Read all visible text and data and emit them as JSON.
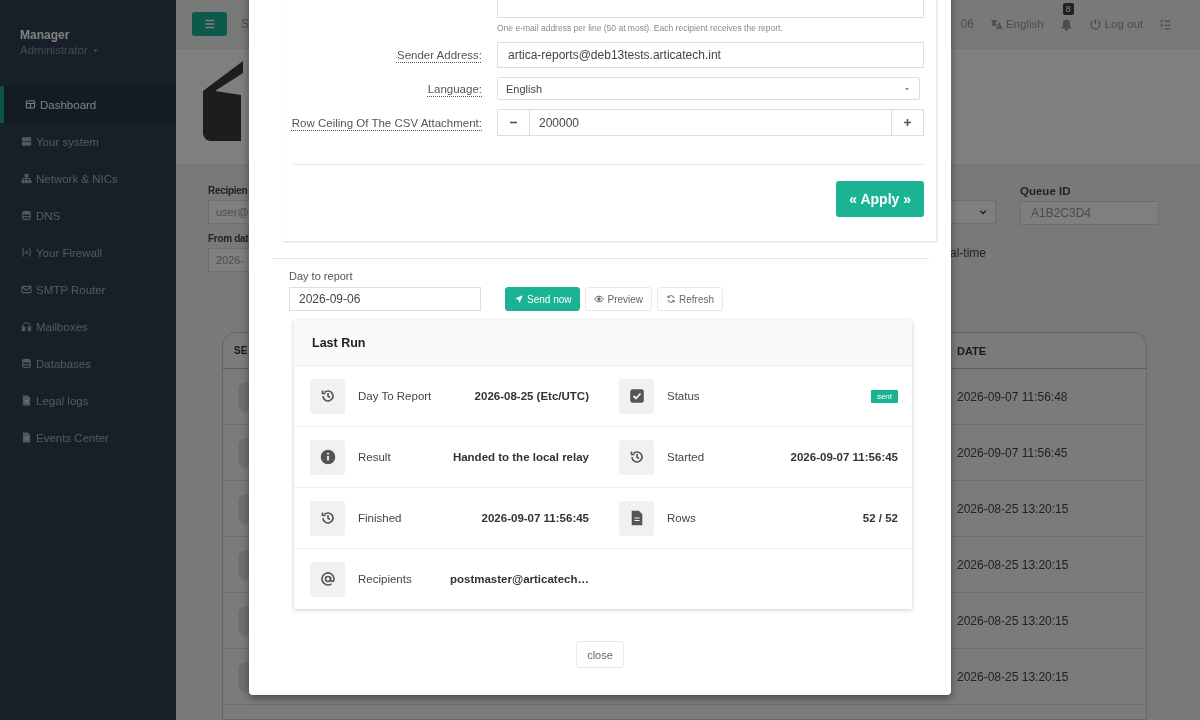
{
  "sidebar": {
    "user": "Manager",
    "role": "Administrator",
    "items": [
      {
        "label": "Dashboard",
        "selected": true
      },
      {
        "label": "Your system",
        "selected": false
      },
      {
        "label": "Network & NICs",
        "selected": false
      },
      {
        "label": "DNS",
        "selected": false
      },
      {
        "label": "Your Firewall",
        "selected": false
      },
      {
        "label": "SMTP Router",
        "selected": false
      },
      {
        "label": "Mailboxes",
        "selected": false
      },
      {
        "label": "Databases",
        "selected": false
      },
      {
        "label": "Legal logs",
        "selected": false
      },
      {
        "label": "Events Center",
        "selected": false
      }
    ]
  },
  "topbar": {
    "search_partial": "S",
    "date_partial": "06",
    "language": "English",
    "notifications": "8",
    "logout": "Log out"
  },
  "filters": {
    "recipient_label": "Recipien",
    "recipient_placeholder": "user@",
    "from_label": "From dat",
    "from_value": "2026-",
    "queue_label": "Queue ID",
    "queue_placeholder": "A1B2C3D4",
    "realtime_label": "al-time"
  },
  "table": {
    "columns": [
      "SE",
      "DATE"
    ],
    "rows": [
      {
        "date": "2026-09-07 11:56:48"
      },
      {
        "date": "2026-09-07 11:56:45"
      },
      {
        "date": "2026-08-25 13:20:15"
      },
      {
        "date": "2026-08-25 13:20:15"
      },
      {
        "date": "2026-08-25 13:20:15"
      },
      {
        "date": "2026-08-25 13:20:15"
      }
    ]
  },
  "modal": {
    "recipients_hint": "One e-mail address per line (50 at most). Each recipient receives the report.",
    "sender_label": "Sender Address:",
    "sender_value": "artica-reports@deb13tests.articatech.int",
    "language_label": "Language:",
    "language_value": "English",
    "ceiling_label": "Row Ceiling Of The CSV Attachment:",
    "ceiling_value": "200000",
    "apply": "« Apply »",
    "day_label": "Day to report",
    "day_value": "2026-09-06",
    "buttons": [
      "Send now",
      "Preview",
      "Refresh"
    ],
    "last_run": {
      "title": "Last Run",
      "fields": [
        {
          "label": "Day To Report",
          "value": "2026-08-25 (Etc/UTC)",
          "kind": "text"
        },
        {
          "label": "Status",
          "value": "sent",
          "kind": "badge"
        },
        {
          "label": "Result",
          "value": "Handed to the local relay",
          "kind": "text"
        },
        {
          "label": "Started",
          "value": "2026-09-07 11:56:45",
          "kind": "text"
        },
        {
          "label": "Finished",
          "value": "2026-09-07 11:56:45",
          "kind": "text"
        },
        {
          "label": "Rows",
          "value": "52 / 52",
          "kind": "text"
        },
        {
          "label": "Recipients",
          "value": "postmaster@articatech…",
          "kind": "text"
        }
      ]
    },
    "close": "close"
  }
}
